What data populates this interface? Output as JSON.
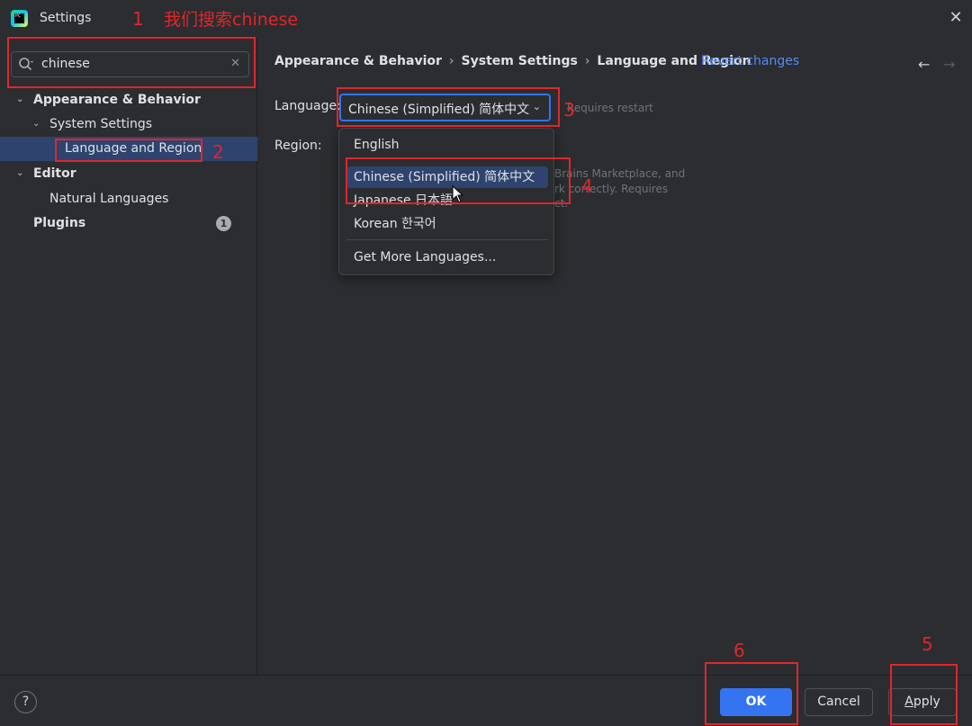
{
  "window": {
    "title": "Settings",
    "icon": "pycharm-icon",
    "app_icon_text": "PC"
  },
  "search": {
    "value": "chinese",
    "icon": "search-icon",
    "clear_icon": "clear-icon"
  },
  "sidebar": {
    "items": [
      {
        "label": "Appearance & Behavior",
        "expanded": true,
        "bold": true
      },
      {
        "label": "System Settings",
        "expanded": true
      },
      {
        "label": "Language and Region",
        "selected": true
      },
      {
        "label": "Editor",
        "expanded": true,
        "bold": true
      },
      {
        "label": "Natural Languages"
      },
      {
        "label": "Plugins",
        "bold": true,
        "badge": "1"
      }
    ]
  },
  "breadcrumb": {
    "items": [
      "Appearance & Behavior",
      "System Settings",
      "Language and Region"
    ],
    "revert_label": "Revert changes"
  },
  "form": {
    "language_label": "Language:",
    "language_value": "Chinese (Simplified) 简体中文",
    "requires_restart": "Requires restart",
    "region_label": "Region:",
    "partial_hint_lines": [
      "Brains Marketplace, and",
      "rk correctly. Requires",
      "ct."
    ]
  },
  "dropdown": {
    "options": [
      "English",
      "Chinese (Simplified) 简体中文",
      "Japanese 日本語",
      "Korean 한국어"
    ],
    "highlighted": "Chinese (Simplified) 简体中文",
    "more": "Get More Languages..."
  },
  "footer": {
    "help_label": "?",
    "ok_label": "OK",
    "cancel_label": "Cancel",
    "apply_label_first": "A",
    "apply_label_rest": "pply"
  },
  "annotations": {
    "color": "#e0262c",
    "steps": [
      "1",
      "2",
      "3",
      "4",
      "5",
      "6"
    ],
    "note": "我们搜索chinese"
  },
  "colors": {
    "accent": "#3574f0",
    "selection": "#2e436e",
    "link": "#548af7",
    "background": "#2b2d30"
  }
}
